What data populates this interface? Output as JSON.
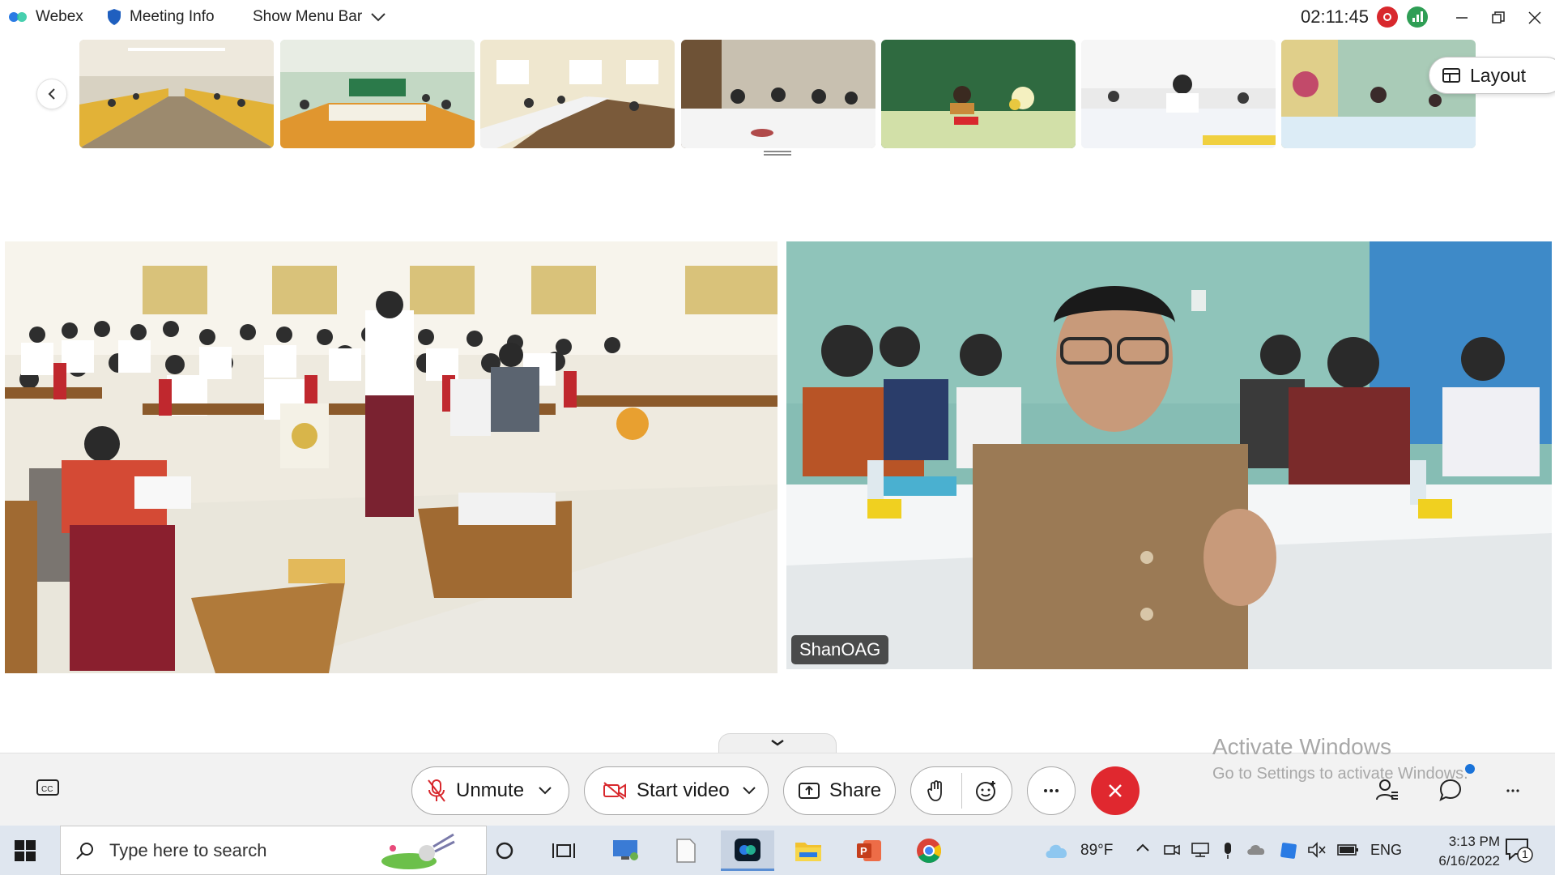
{
  "titlebar": {
    "app_name": "Webex",
    "meeting_info": "Meeting Info",
    "show_menu_bar": "Show Menu Bar",
    "timer": "02:11:45"
  },
  "filmstrip": {
    "layout_label": "Layout",
    "thumbnails": [
      {
        "bg": "#b8a46a"
      },
      {
        "bg": "#a8b89a"
      },
      {
        "bg": "#c9b27d"
      },
      {
        "bg": "#9c8f78"
      },
      {
        "bg": "#3f7a4d"
      },
      {
        "bg": "#c8c3c8"
      },
      {
        "bg": "#9bb9a8"
      }
    ]
  },
  "main": {
    "video2_name": "ShanOAG"
  },
  "controls": {
    "unmute_label": "Unmute",
    "start_video_label": "Start video",
    "share_label": "Share"
  },
  "watermark": {
    "line1": "Activate Windows",
    "line2": "Go to Settings to activate Windows."
  },
  "taskbar": {
    "search_placeholder": "Type here to search",
    "temperature": "89°F",
    "language": "ENG",
    "time": "3:13 PM",
    "date": "6/16/2022",
    "notification_count": "1"
  },
  "colors": {
    "end_call": "#e0282f",
    "recording": "#d8282d",
    "stats": "#2f9e55",
    "taskbar": "#dfe6ef"
  }
}
